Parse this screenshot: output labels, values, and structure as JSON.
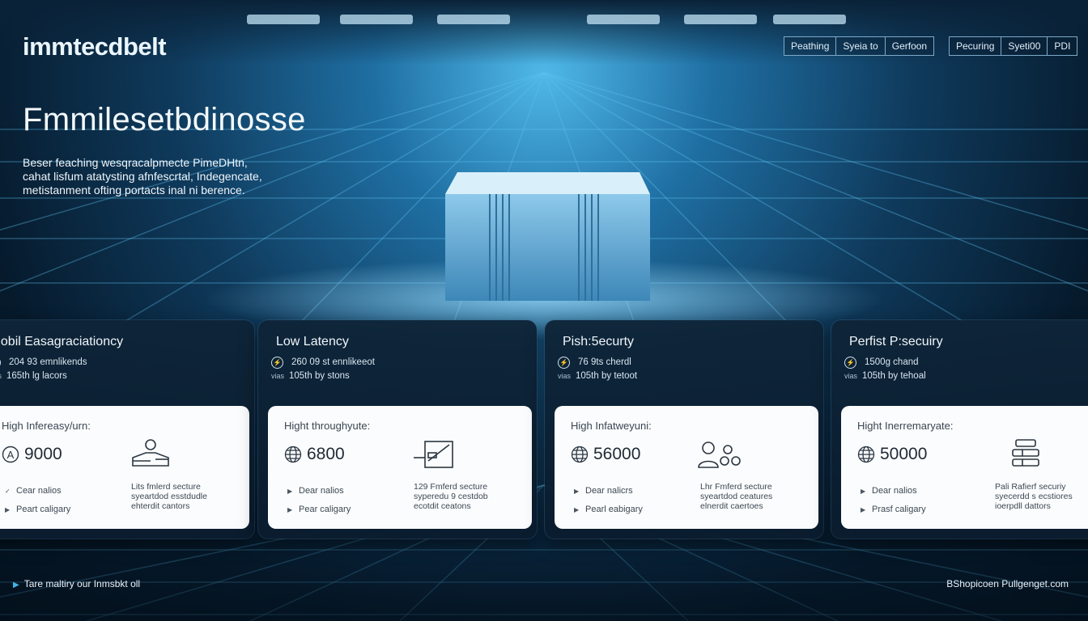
{
  "brand": {
    "logo_text": "immtecdbelt",
    "accent": "#3fb3ea",
    "background": "#061a2c"
  },
  "nav": {
    "group1": [
      {
        "label": "Peathing"
      },
      {
        "label": "Syeia to"
      },
      {
        "label": "Gerfoon"
      }
    ],
    "group2": [
      {
        "label": "Pecuring"
      },
      {
        "label": "Syeti00"
      },
      {
        "label": "PDI"
      }
    ]
  },
  "hero": {
    "title": "Fmmilesetbdinosse",
    "description_lines": [
      "Beser feaching wesqracalpmecte PimeDHtn,",
      "cahat lisfum atatysting afnfescrtal, Indegencate,",
      "metistanment ofting portacts inal ni berence."
    ]
  },
  "cards": [
    {
      "title": "nobil Easagraciationcy",
      "stats": [
        {
          "prefix": "",
          "text": "204 93 emnlikends"
        },
        {
          "prefix": "vias",
          "text": "165th lg lacors"
        }
      ],
      "label": "High Infereasy/urn:",
      "value": "9000",
      "value_icon": "circle-a-icon",
      "feature_icon": "person-device-icon",
      "bullets": [
        "Cear nalios",
        "Peart caligary"
      ],
      "notes": [
        "Lits fmlerd secture",
        "syeartdod esstdudle",
        "ehterdit cantors"
      ]
    },
    {
      "title": "Low Latency",
      "stats": [
        {
          "prefix": "",
          "text": "260 09 st ennlikeeot"
        },
        {
          "prefix": "vias",
          "text": "105th by stons"
        }
      ],
      "label": "Hight throughyute:",
      "value": "6800",
      "value_icon": "globe-icon",
      "feature_icon": "chart-panel-icon",
      "bullets": [
        "Dear nalios",
        "Pear caligary"
      ],
      "notes": [
        "129 Fmferd secture",
        "syperedu 9 cestdob",
        "ecotdit ceatons"
      ]
    },
    {
      "title": "Pish:5ecurty",
      "stats": [
        {
          "prefix": "",
          "text": "76 9ts cherdl"
        },
        {
          "prefix": "vias",
          "text": "105th by tetoot"
        }
      ],
      "label": "High Infatweyuni:",
      "value": "56000",
      "value_icon": "globe-icon",
      "feature_icon": "user-nodes-icon",
      "bullets": [
        "Dear nalicrs",
        "Pearl eabigary"
      ],
      "notes": [
        "Lhr Fmferd secture",
        "syeartdod ceatures",
        "elnerdit caertoes"
      ]
    },
    {
      "title": "Perfist P:secuiry",
      "stats": [
        {
          "prefix": "",
          "text": "1500g chand"
        },
        {
          "prefix": "vias",
          "text": "105th by tehoal"
        }
      ],
      "label": "Hight Inerremaryate:",
      "value": "50000",
      "value_icon": "globe-icon",
      "feature_icon": "server-stack-icon",
      "bullets": [
        "Dear nalios",
        "Prasf caligary"
      ],
      "notes": [
        "Pali Rafierf securiy",
        "syecerdd s ecstiores",
        "ioerpdll dattors"
      ]
    }
  ],
  "footer": {
    "left": "Tare maltiry our Inmsbkt oll",
    "right": "BShopicoen Pullgenget.com"
  }
}
